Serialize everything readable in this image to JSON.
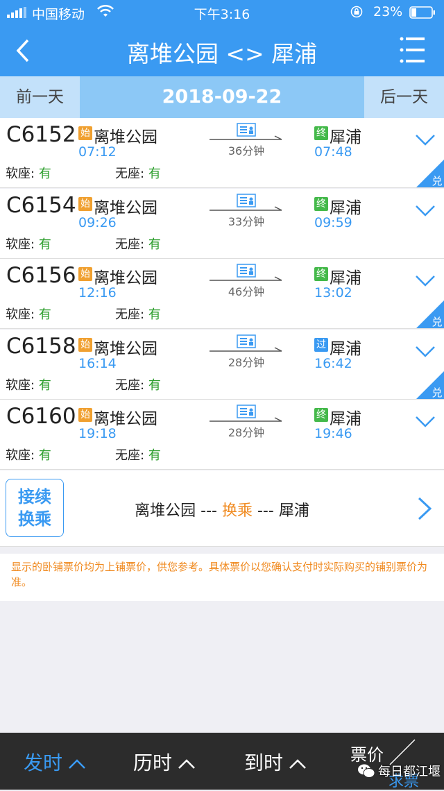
{
  "status_bar": {
    "carrier": "中国移动",
    "time": "下午3:16",
    "battery": "23%"
  },
  "nav": {
    "title": "离堆公园 <> 犀浦"
  },
  "date_bar": {
    "prev": "前一天",
    "date": "2018-09-22",
    "next": "后一天"
  },
  "trains": [
    {
      "number": "C6152",
      "from_badge": "始",
      "from": "离堆公园",
      "depart": "07:12",
      "duration": "36分钟",
      "to_badge": "终",
      "to": "犀浦",
      "arrive": "07:48",
      "seat1_label": "软座:",
      "seat1_value": "有",
      "seat2_label": "无座:",
      "seat2_value": "有",
      "corner": "兑"
    },
    {
      "number": "C6154",
      "from_badge": "始",
      "from": "离堆公园",
      "depart": "09:26",
      "duration": "33分钟",
      "to_badge": "终",
      "to": "犀浦",
      "arrive": "09:59",
      "seat1_label": "软座:",
      "seat1_value": "有",
      "seat2_label": "无座:",
      "seat2_value": "有",
      "corner": ""
    },
    {
      "number": "C6156",
      "from_badge": "始",
      "from": "离堆公园",
      "depart": "12:16",
      "duration": "46分钟",
      "to_badge": "终",
      "to": "犀浦",
      "arrive": "13:02",
      "seat1_label": "软座:",
      "seat1_value": "有",
      "seat2_label": "无座:",
      "seat2_value": "有",
      "corner": "兑"
    },
    {
      "number": "C6158",
      "from_badge": "始",
      "from": "离堆公园",
      "depart": "16:14",
      "duration": "28分钟",
      "to_badge": "过",
      "to": "犀浦",
      "arrive": "16:42",
      "seat1_label": "软座:",
      "seat1_value": "有",
      "seat2_label": "无座:",
      "seat2_value": "有",
      "corner": "兑"
    },
    {
      "number": "C6160",
      "from_badge": "始",
      "from": "离堆公园",
      "depart": "19:18",
      "duration": "28分钟",
      "to_badge": "终",
      "to": "犀浦",
      "arrive": "19:46",
      "seat1_label": "软座:",
      "seat1_value": "有",
      "seat2_label": "无座:",
      "seat2_value": "有",
      "corner": ""
    }
  ],
  "transfer": {
    "box_line1": "接续",
    "box_line2": "换乘",
    "from": "离堆公园",
    "sep1": " --- ",
    "middle": "换乘",
    "sep2": " --- ",
    "to": "犀浦"
  },
  "note": "显示的卧铺票价均为上铺票价，供您参考。具体票价以您确认支付时实际购买的铺别票价为准。",
  "bottom": {
    "sort1": "发时",
    "sort2": "历时",
    "sort3": "到时",
    "price": "票价",
    "under": "求票",
    "watermark": "每日都江堰"
  },
  "colors": {
    "primary": "#3a9af2",
    "accent": "#f08a20",
    "available": "#2a9d2a",
    "terminal_badge": "#44b94a"
  }
}
